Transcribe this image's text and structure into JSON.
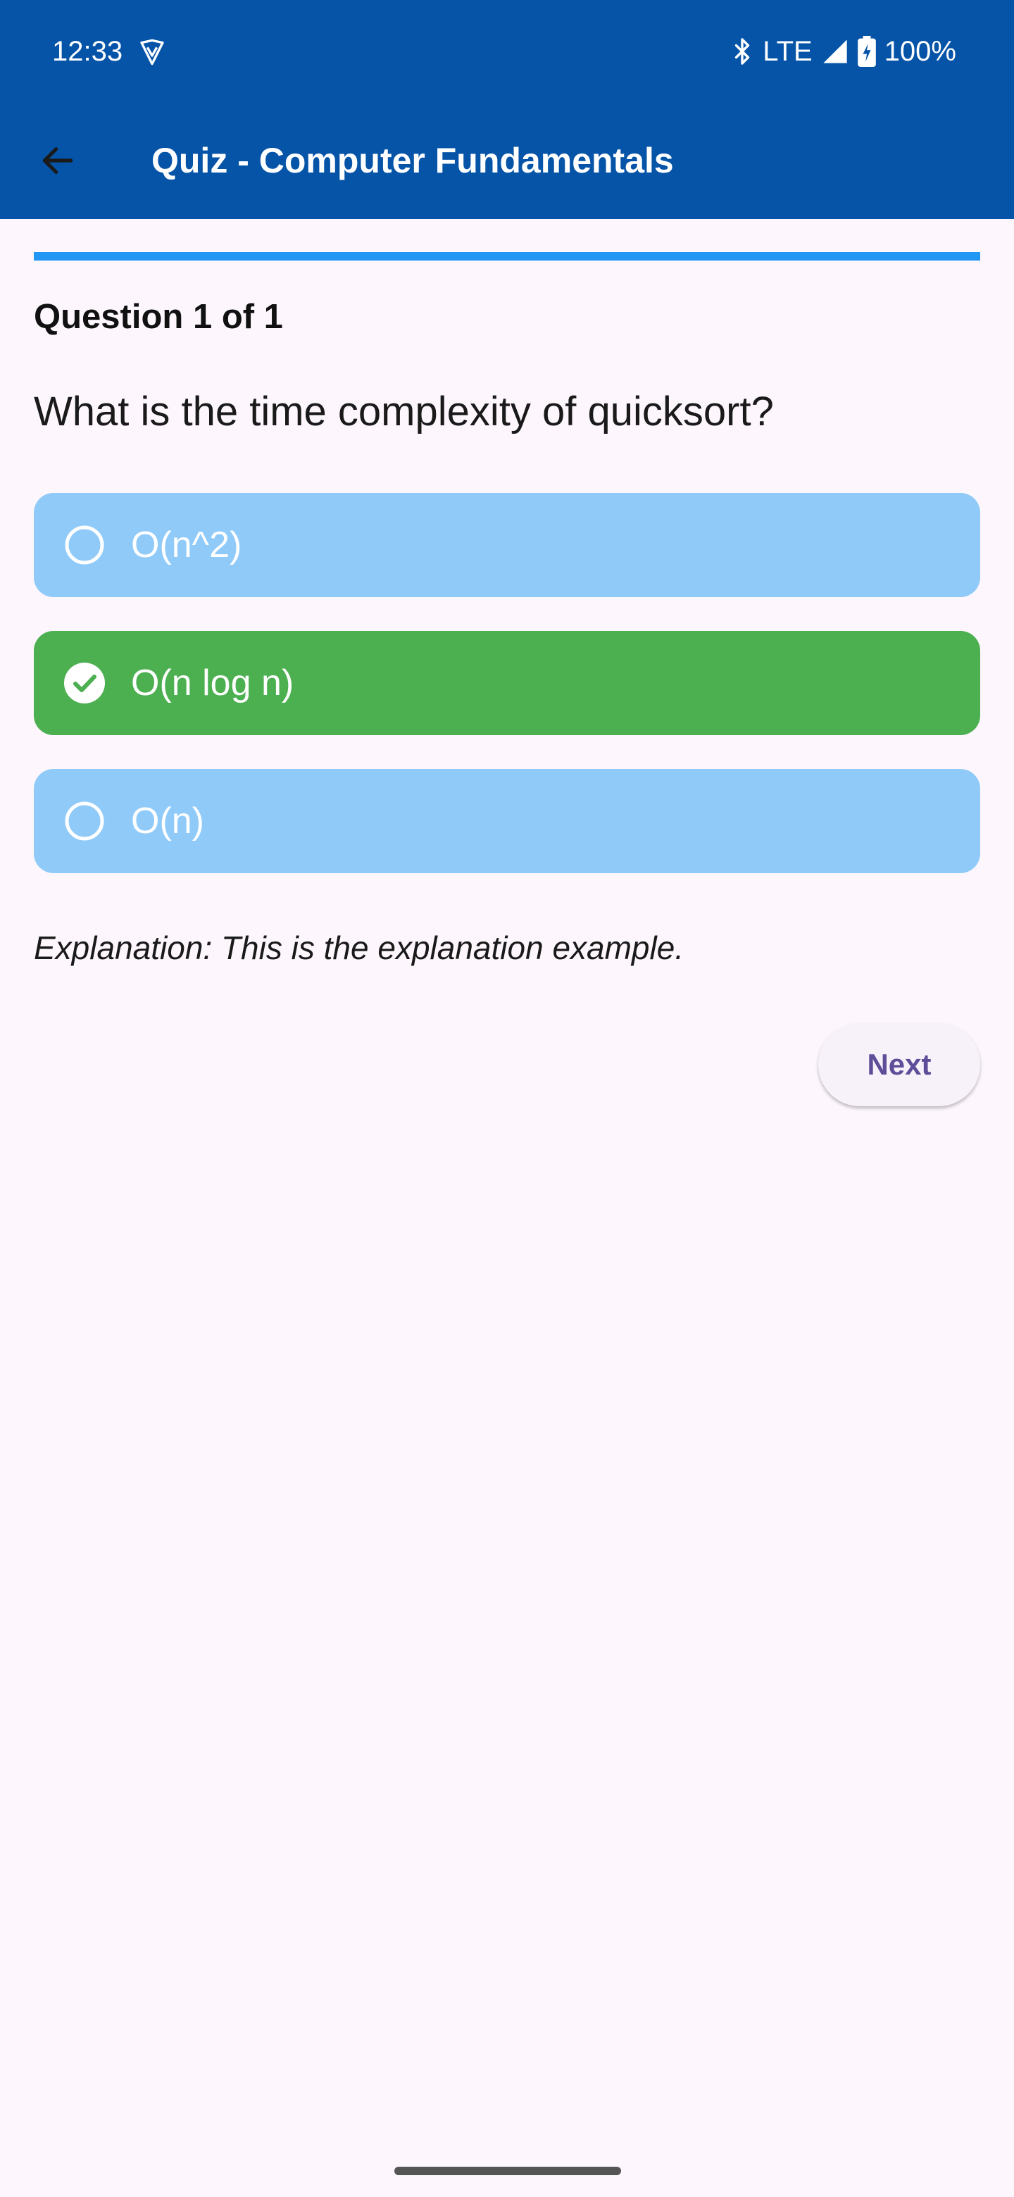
{
  "status_bar": {
    "time": "12:33",
    "network": "LTE",
    "battery": "100%",
    "icons": [
      "vpn-icon",
      "bluetooth-icon",
      "signal-icon",
      "battery-charging-icon"
    ]
  },
  "app_bar": {
    "back_icon": "arrow-back-icon",
    "title": "Quiz - Computer Fundamentals"
  },
  "quiz": {
    "progress_fraction": 1.0,
    "question_counter": "Question 1 of 1",
    "question": "What is the time complexity of quicksort?",
    "options": [
      {
        "label": "O(n^2)",
        "state": "unselected",
        "icon": "radio-unchecked-icon"
      },
      {
        "label": "O(n log n)",
        "state": "correct",
        "icon": "check-circle-icon"
      },
      {
        "label": "O(n)",
        "state": "unselected",
        "icon": "radio-unchecked-icon"
      }
    ],
    "explanation": "Explanation: This is the explanation example.",
    "next_label": "Next"
  },
  "colors": {
    "app_bar": "#0554a8",
    "background": "#fdf7fd",
    "progress": "#2196f3",
    "option_default": "#90caf9",
    "option_correct": "#4caf50",
    "next_text": "#5e4d98"
  }
}
